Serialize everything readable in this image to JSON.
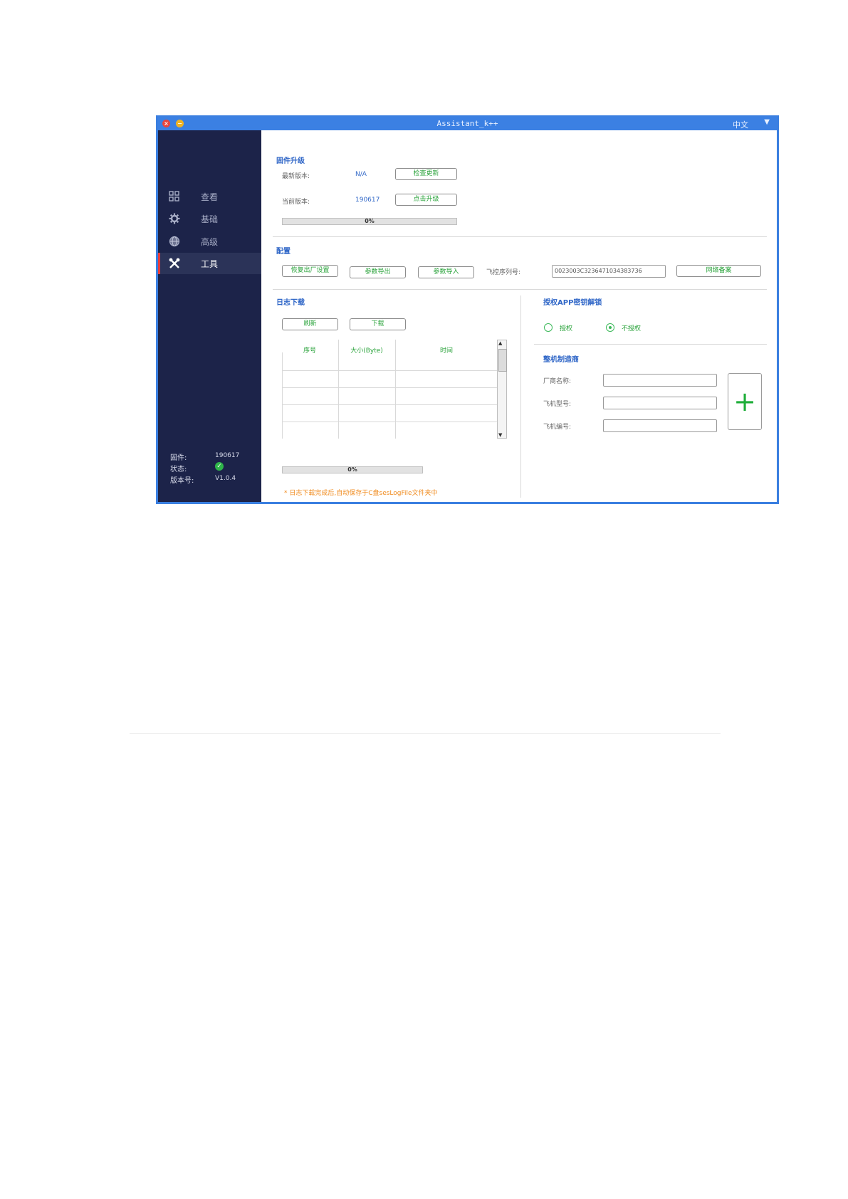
{
  "window": {
    "title": "Assistant_k++",
    "close_glyph": "×",
    "min_glyph": "−",
    "language": "中文",
    "language_caret": "▼"
  },
  "sidebar": {
    "items": [
      {
        "label": "查看",
        "icon": "view-icon"
      },
      {
        "label": "基础",
        "icon": "gear-icon"
      },
      {
        "label": "高级",
        "icon": "globe-icon"
      },
      {
        "label": "工具",
        "icon": "tools-icon",
        "active": true
      }
    ],
    "status": {
      "firmware_label": "固件:",
      "firmware_value": "190617",
      "state_label": "状态:",
      "state_icon": "✓",
      "version_label": "版本号:",
      "version_value": "V1.0.4"
    }
  },
  "firmware": {
    "title": "固件升级",
    "latest_label": "最新版本:",
    "latest_value": "N/A",
    "check_button": "检查更新",
    "current_label": "当前版本:",
    "current_value": "190617",
    "upgrade_button": "点击升级",
    "progress": 0,
    "progress_text": "0%"
  },
  "config": {
    "title": "配置",
    "factory_reset_button": "恢复出厂设置",
    "export_button": "参数导出",
    "import_button": "参数导入",
    "serial_label": "飞控序列号:",
    "serial_value": "0023003C3236471034383736",
    "network_backup_button": "网络备案"
  },
  "log": {
    "title": "日志下载",
    "refresh_button": "刷新",
    "download_button": "下载",
    "columns": [
      "序号",
      "大小(Byte)",
      "时间"
    ],
    "rows": [],
    "scroll_up": "▲",
    "scroll_down": "▼",
    "progress": 0,
    "progress_text": "0%",
    "note": "*  日志下载完成后,自动保存于C盘sesLogFile文件夹中"
  },
  "auth": {
    "title": "授权APP密钥解锁",
    "option_authorize": "授权",
    "option_unauthorize": "不授权",
    "selected": "不授权"
  },
  "manufacturer": {
    "title": "整机制造商",
    "name_label": "厂商名称:",
    "model_label": "飞机型号:",
    "number_label": "飞机编号:",
    "name_value": "",
    "model_value": "",
    "number_value": "",
    "add_glyph": "+"
  },
  "colors": {
    "titlebar": "#3b80e3",
    "sidebar": "#1c2349",
    "accent_blue": "#2f66c7",
    "accent_green": "#2aa33b",
    "note_orange": "#f08a1c",
    "active_marker": "#e63b3b"
  }
}
